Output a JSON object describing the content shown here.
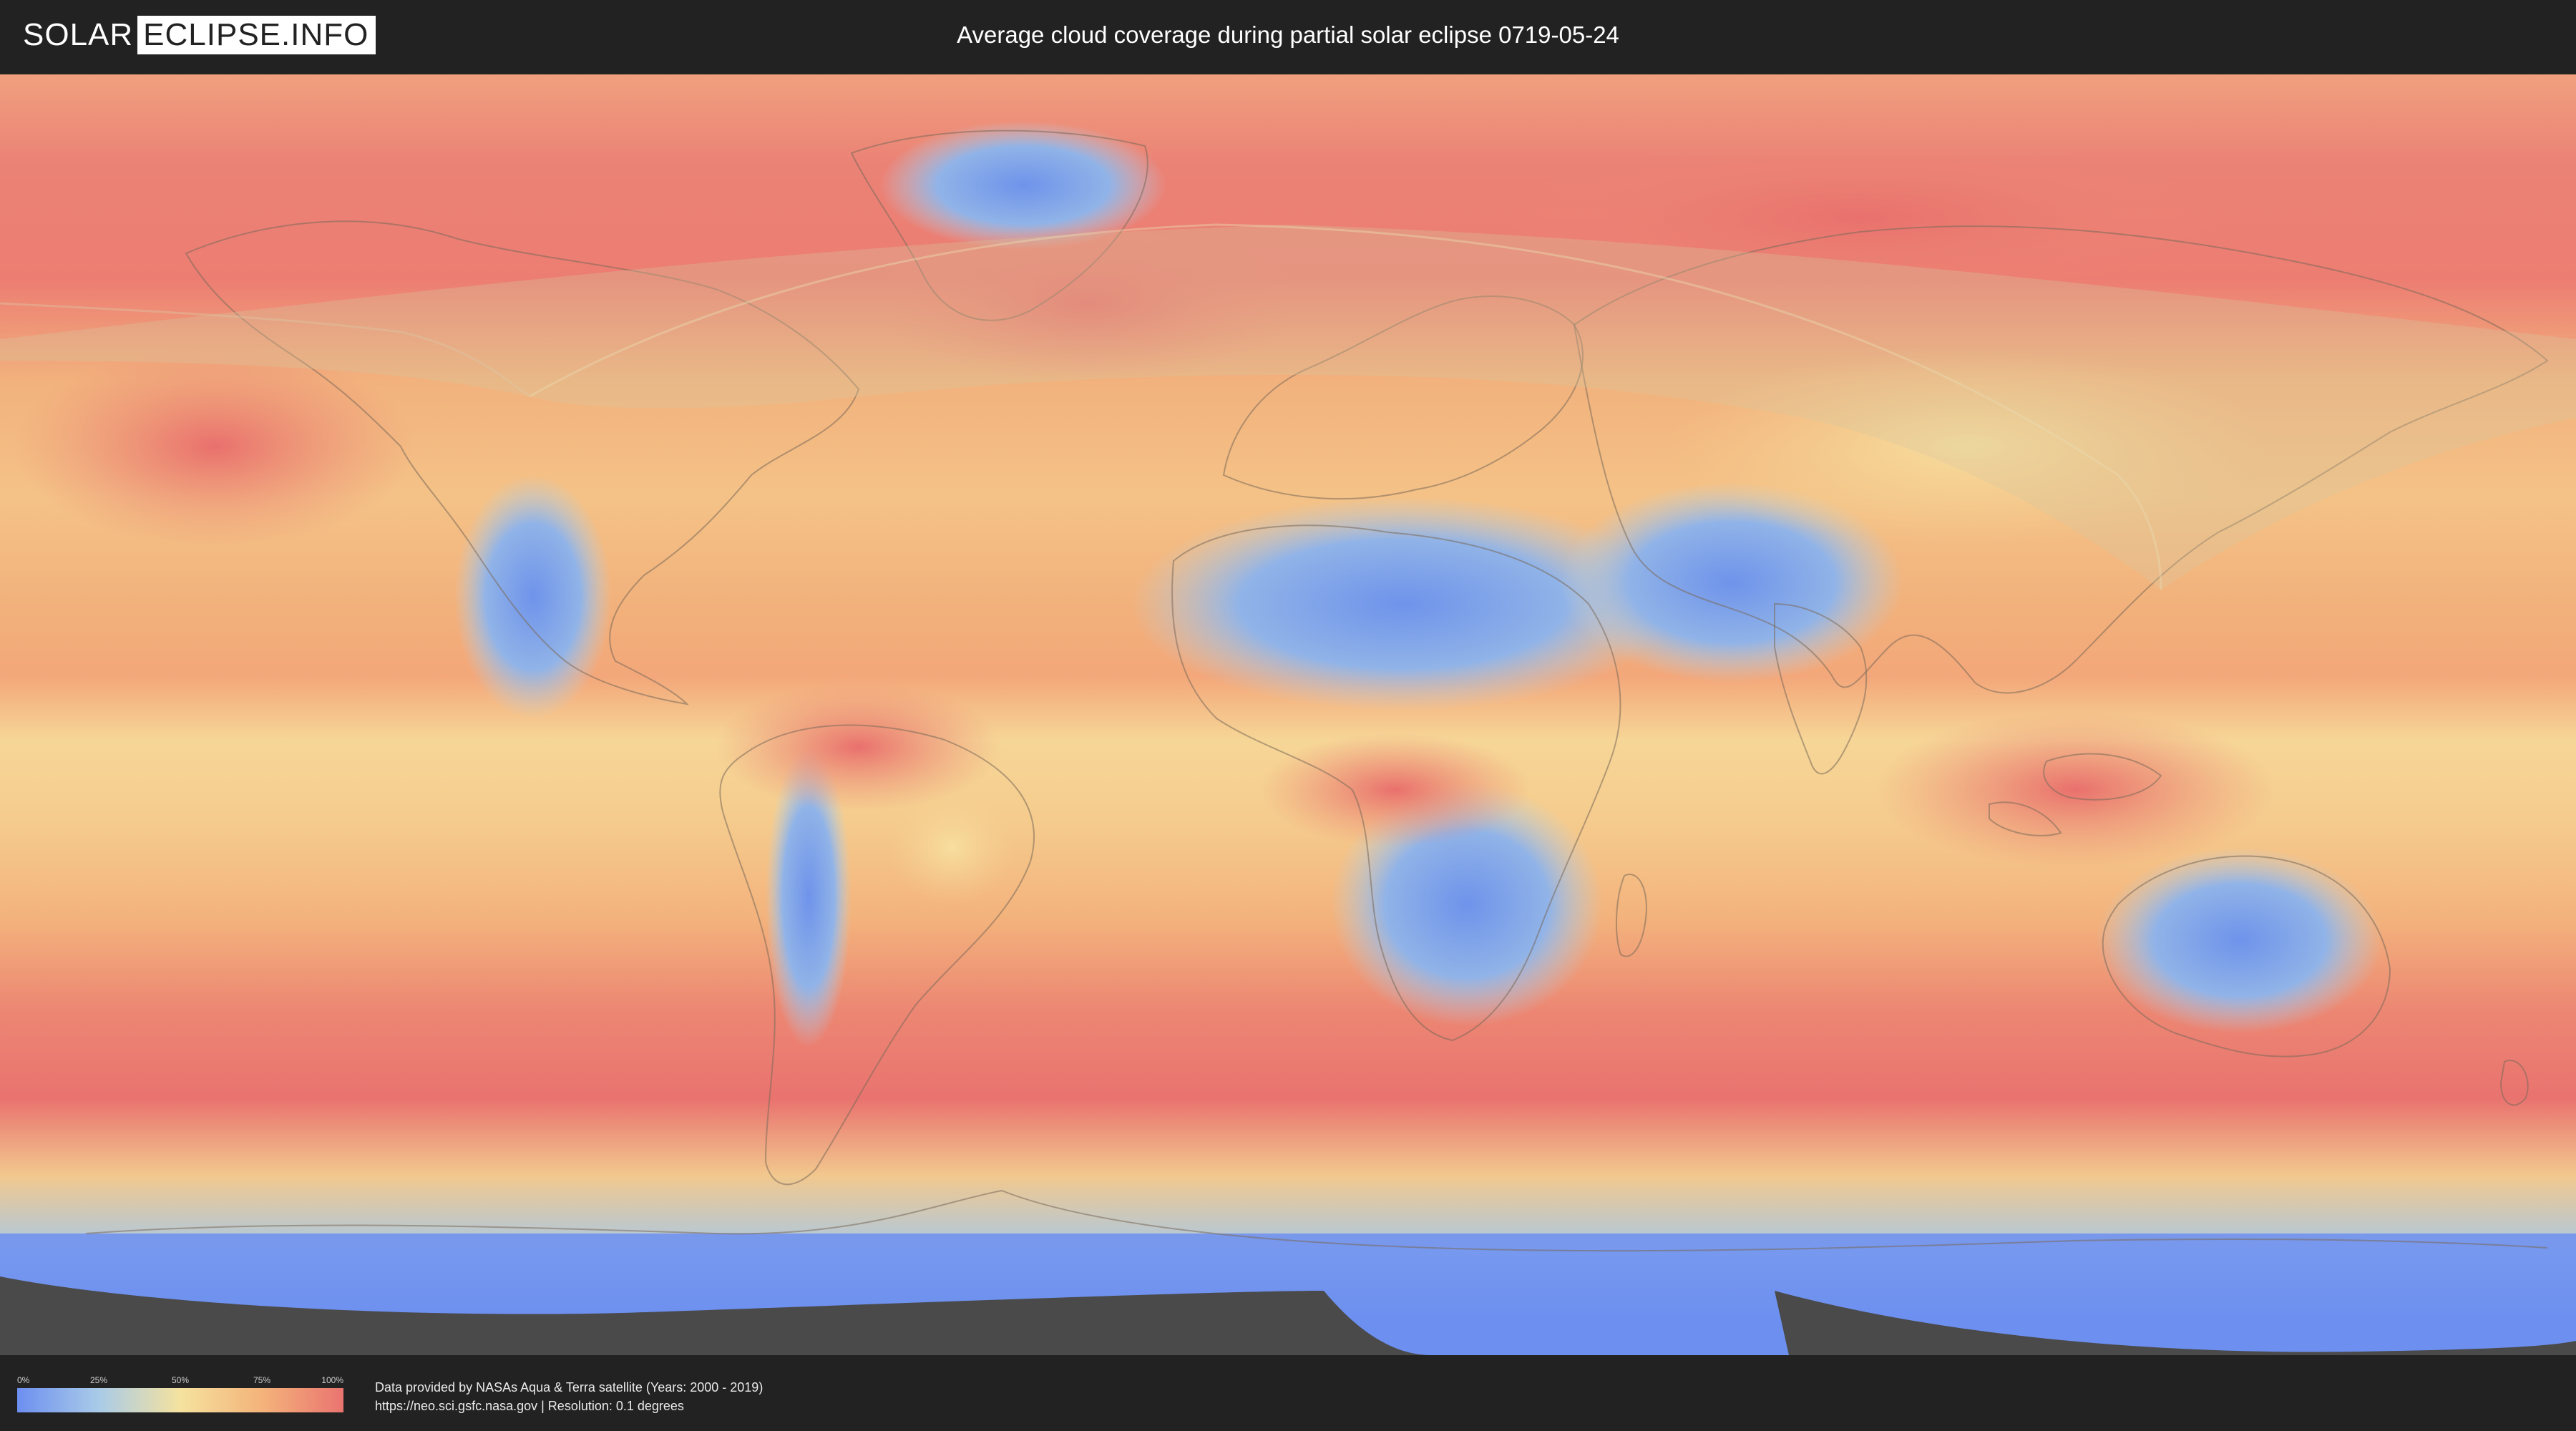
{
  "header": {
    "logo_left": "SOLAR",
    "logo_right": "ECLIPSE.INFO",
    "title": "Average cloud coverage during partial solar eclipse 0719-05-24"
  },
  "legend": {
    "ticks": [
      {
        "label": "0%",
        "fraction": 0
      },
      {
        "label": "25%",
        "fraction": 0.25
      },
      {
        "label": "50%",
        "fraction": 0.5
      },
      {
        "label": "75%",
        "fraction": 0.75
      },
      {
        "label": "100%",
        "fraction": 1
      }
    ],
    "colors": {
      "low": "#6d8ff0",
      "mid_low": "#a9cbe8",
      "mid": "#f5e29e",
      "mid_high": "#f4b37a",
      "high": "#ea7470"
    }
  },
  "footer": {
    "credit_line_1": "Data provided by NASAs Aqua & Terra satellite (Years: 2000 - 2019)",
    "credit_line_2": "https://neo.sci.gsfc.nasa.gov | Resolution: 0.1 degrees"
  }
}
